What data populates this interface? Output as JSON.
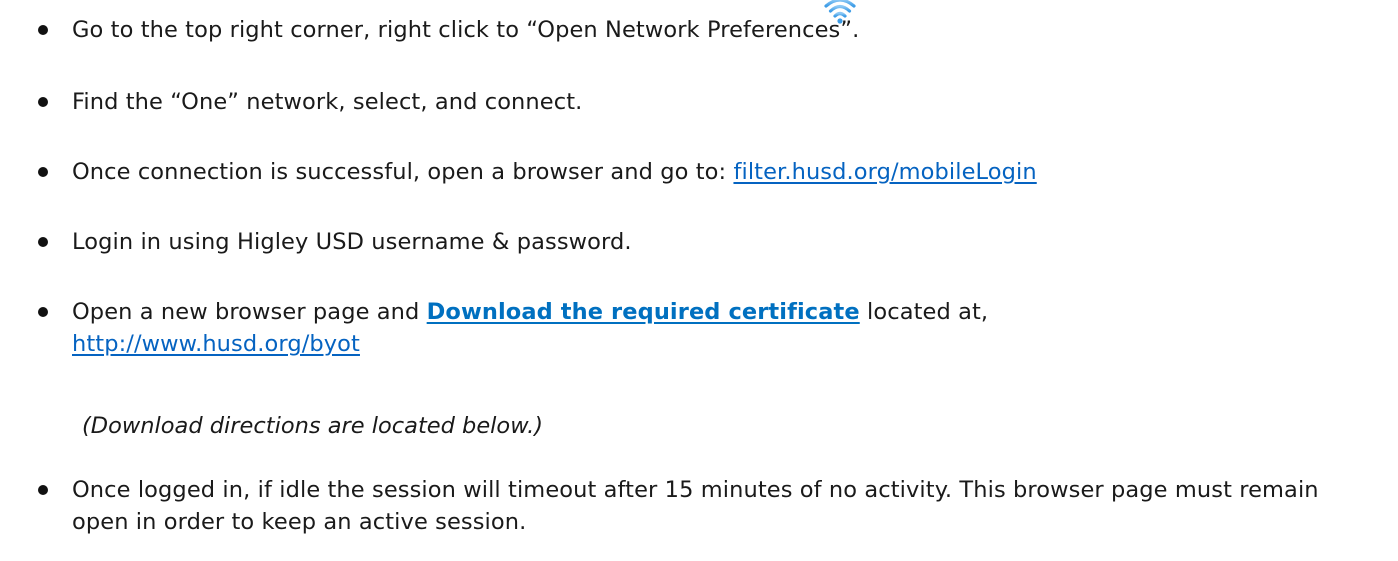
{
  "icons": {
    "wifi": "wifi-icon",
    "wifi_color": "#3d9ce6"
  },
  "colors": {
    "link": "#0563c1",
    "link_bold": "#0070c0",
    "text": "#1a1a1a"
  },
  "steps": [
    {
      "text": "Go to the top right corner, right click to “Open Network Preferences”."
    },
    {
      "text": "Find the “One” network, select, and connect."
    },
    {
      "text_before": "Once connection is successful, open a browser and go to: ",
      "link": "filter.husd.org/mobileLogin"
    },
    {
      "text": "Login in using Higley USD username &  password."
    },
    {
      "text_before": "Open a new browser page and ",
      "link": "Download the required certificate",
      "text_after": " located at,",
      "link2": "http://www.husd.org/byot"
    },
    {
      "text": "Once logged in, if idle the session will timeout after 15 minutes of no activity. This browser page must remain open in order to keep an active session."
    }
  ],
  "note": "(Download directions are located below.)"
}
